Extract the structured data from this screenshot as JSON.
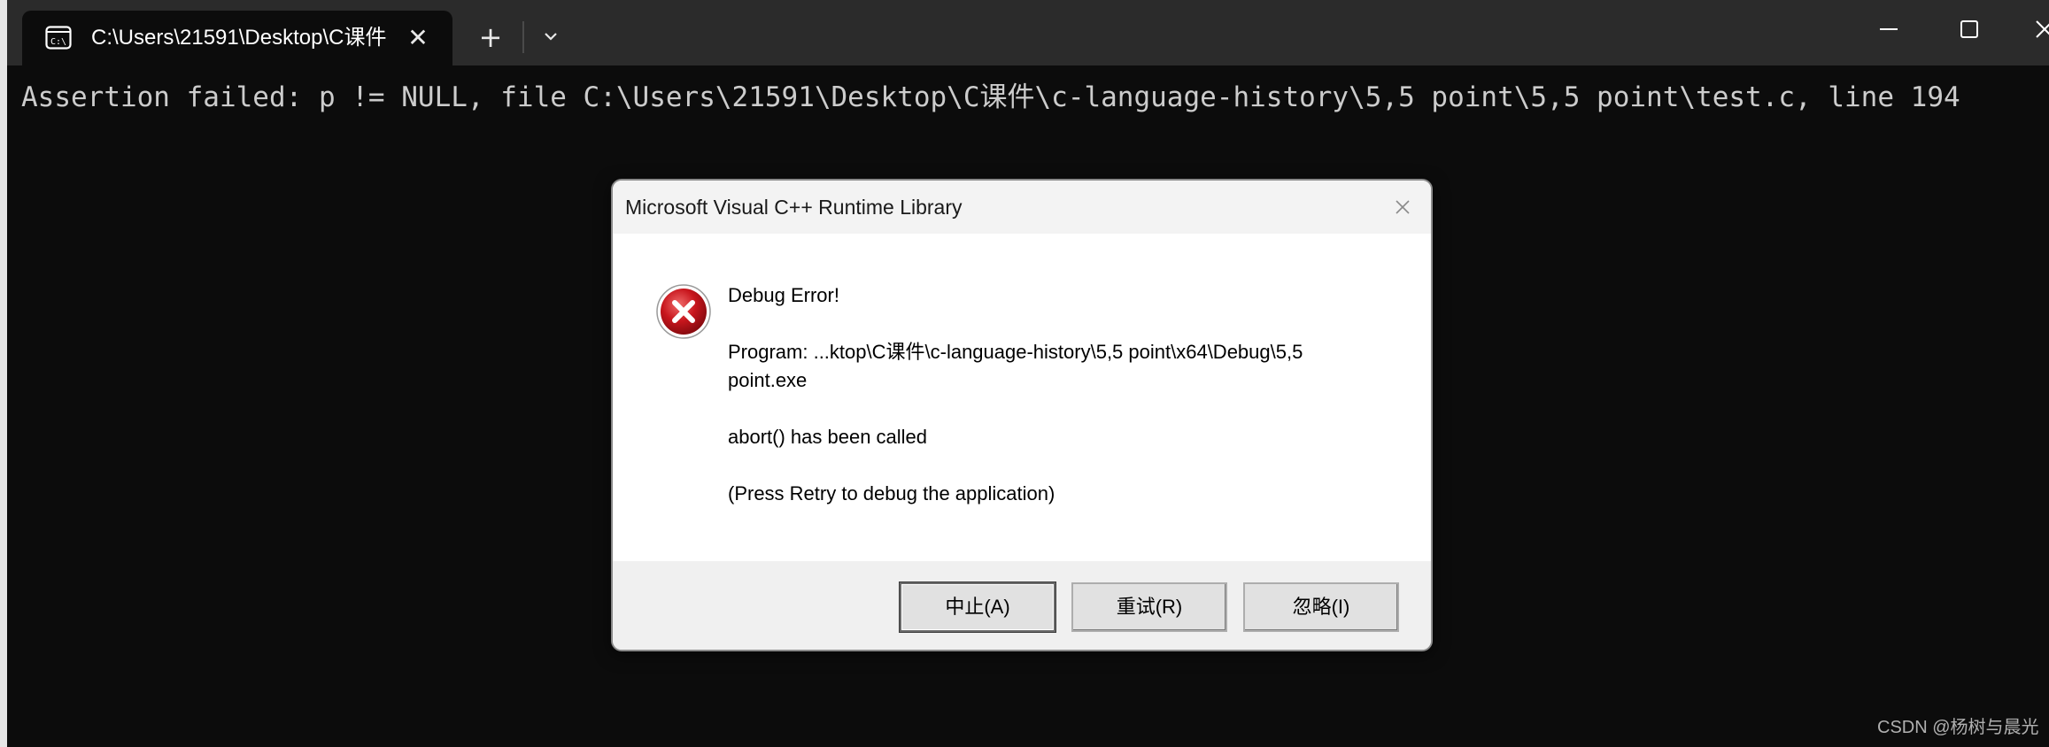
{
  "terminal": {
    "tab": {
      "title": "C:\\Users\\21591\\Desktop\\C课件",
      "icon": "console-icon",
      "close_icon": "close-icon"
    },
    "new_tab_label": "+",
    "dropdown_icon": "chevron-down-icon",
    "window_controls": [
      "minimize-icon",
      "maximize-icon",
      "close-icon"
    ],
    "console_output": "Assertion failed: p != NULL, file C:\\Users\\21591\\Desktop\\C课件\\c-language-history\\5,5 point\\5,5 point\\test.c, line 194"
  },
  "dialog": {
    "title": "Microsoft Visual C++ Runtime Library",
    "icon": "error-icon",
    "heading": "Debug Error!",
    "program_line_1": "Program: ...ktop\\C课件\\c-language-history\\5,5 point\\x64\\Debug\\5,5",
    "program_line_2": "point.exe",
    "abort_message": "abort() has been called",
    "hint": "(Press Retry to debug the application)",
    "buttons": {
      "abort": "中止(A)",
      "retry": "重试(R)",
      "ignore": "忽略(I)"
    }
  },
  "watermark": "CSDN @杨树与晨光",
  "colors": {
    "console_bg": "#0c0c0c",
    "titlebar_bg": "#2b2b2b",
    "console_text": "#cccccc",
    "error_red": "#c8161d"
  }
}
